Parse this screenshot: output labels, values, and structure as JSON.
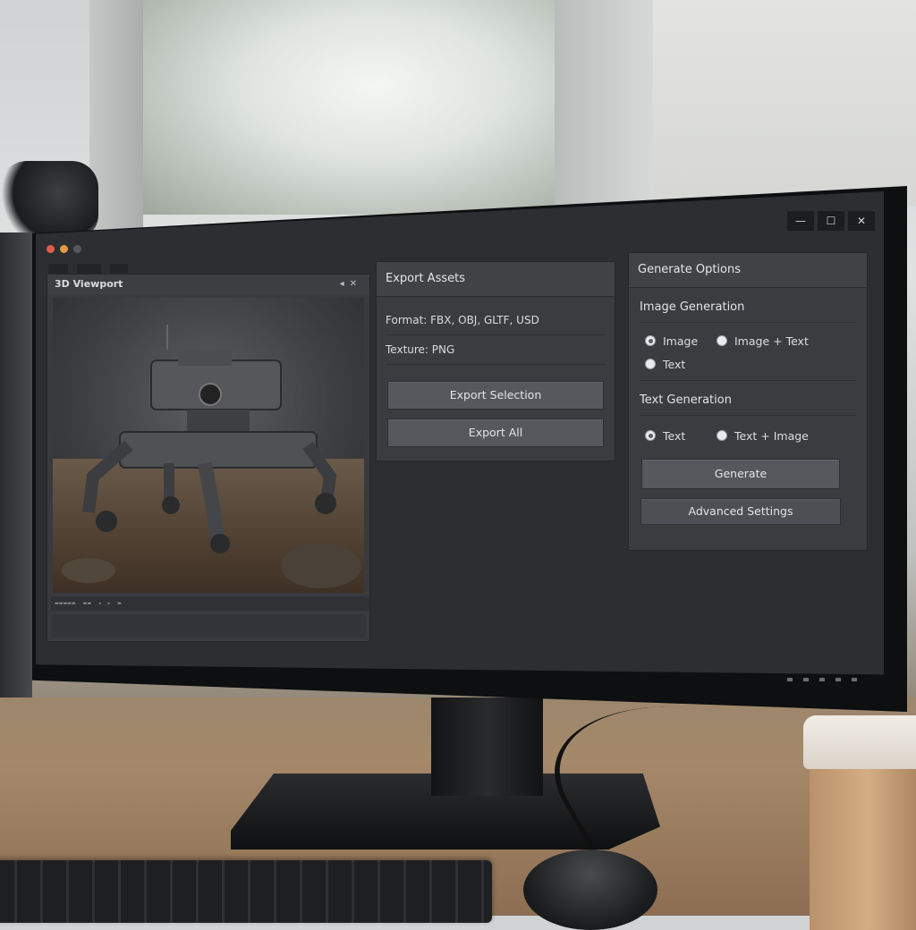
{
  "viewport": {
    "title": "3D Viewport",
    "icons": [
      "pin-icon",
      "close-icon"
    ]
  },
  "export_panel": {
    "title": "Export Assets",
    "format": "Format: FBX, OBJ, GLTF, USD",
    "texture": "Texture: PNG",
    "export_selection_label": "Export Selection",
    "export_all_label": "Export All"
  },
  "generate_panel": {
    "title": "Generate Options",
    "image_generation": {
      "title": "Image Generation",
      "options": [
        {
          "label": "Image",
          "selected": true
        },
        {
          "label": "Image + Text",
          "selected": false
        },
        {
          "label": "Text",
          "selected": false
        }
      ]
    },
    "text_generation": {
      "title": "Text Generation",
      "options": [
        {
          "label": "Text",
          "selected": true
        },
        {
          "label": "Text + Image",
          "selected": false
        }
      ]
    },
    "generate_label": "Generate",
    "advanced_label": "Advanced Settings"
  },
  "window_controls": {
    "minimize": "—",
    "maximize": "☐",
    "close": "✕"
  },
  "colors": {
    "panel_bg": "#3a3c40",
    "button_bg": "#55585d",
    "dot_red": "#e25b4a",
    "dot_orange": "#e39a42"
  }
}
